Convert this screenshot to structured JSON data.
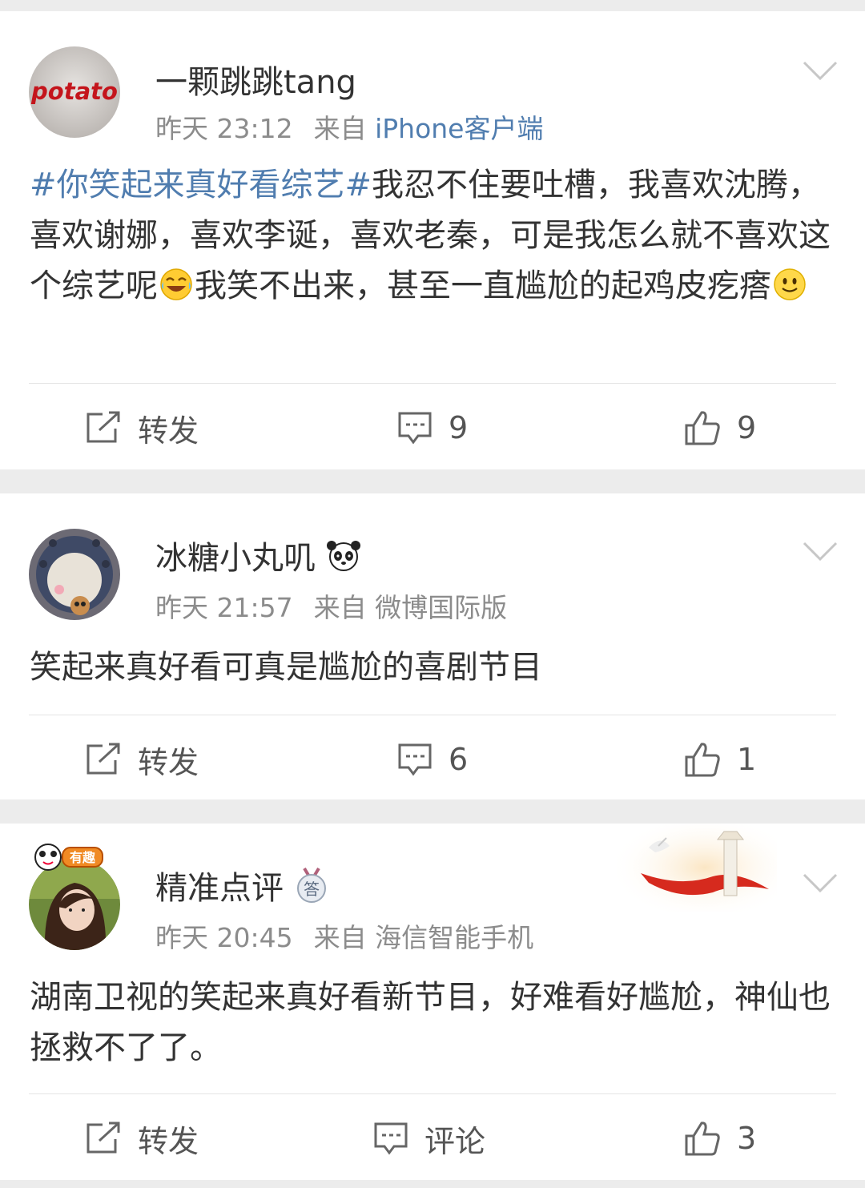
{
  "posts": [
    {
      "user": "一颗跳跳tang",
      "avatar_text": "potato",
      "time": "昨天 23:12",
      "source_prefix": "来自",
      "source": "iPhone客户端",
      "hashtag": "#你笑起来真好看综艺#",
      "text_a": "我忍不住要吐槽，我喜欢沈腾，喜欢谢娜，喜欢李诞，喜欢老秦，可是我怎么就不喜欢这个综艺呢",
      "text_b": "我笑不出来，甚至一直尴尬的起鸡皮疙瘩",
      "repost_label": "转发",
      "comment_label": "9",
      "like_count": "9"
    },
    {
      "user": "冰糖小丸叽",
      "user_badge_icon": "panda-icon",
      "time": "昨天 21:57",
      "source_prefix": "来自",
      "source": "微博国际版",
      "text": "笑起来真好看可真是尴尬的喜剧节目",
      "repost_label": "转发",
      "comment_label": "6",
      "like_count": "1"
    },
    {
      "user": "精准点评",
      "user_badge_icon": "medal-answer-icon",
      "badge_char": "答",
      "avatar_badge": "有趣",
      "time": "昨天 20:45",
      "source_prefix": "来自",
      "source": "海信智能手机",
      "text": "湖南卫视的笑起来真好看新节目，好难看好尴尬，神仙也拯救不了了。",
      "repost_label": "转发",
      "comment_label": "评论",
      "like_count": "3"
    }
  ],
  "colors": {
    "link": "#507daf",
    "meta": "#8c8c8c",
    "text": "#333333",
    "separator": "#ececec"
  }
}
